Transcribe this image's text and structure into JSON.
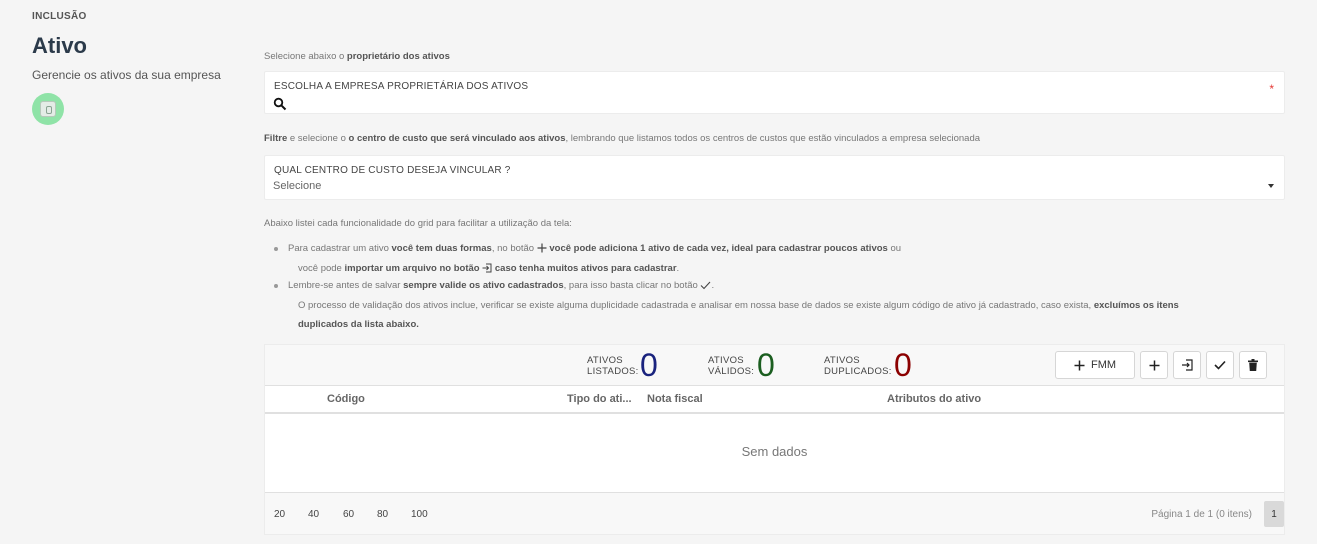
{
  "header": {
    "breadcrumb": "INCLUSÃO",
    "title": "Ativo",
    "subtitle": "Gerencie os ativos da sua empresa",
    "avatar_icon": "safe-icon",
    "avatar_color": "#8fe3a7"
  },
  "owner": {
    "hint_prefix": "Selecione abaixo o ",
    "hint_bold": "proprietário dos ativos",
    "label": "ESCOLHA A EMPRESA PROPRIETÁRIA DOS ATIVOS",
    "required_mark": "*",
    "value": ""
  },
  "cost_center": {
    "hint_bold1": "Filtre",
    "hint_mid": " e selecione o ",
    "hint_bold2": "o centro de custo que será vinculado aos ativos",
    "hint_rest": ", lembrando que listamos todos os centros de custos que estão vinculados a empresa selecionada",
    "label": "QUAL CENTRO DE CUSTO DESEJA VINCULAR ?",
    "value": "Selecione"
  },
  "instructions": {
    "intro": "Abaixo listei cada funcionalidade do grid para facilitar a utilização da tela:",
    "b1_a": "Para cadastrar um ativo ",
    "b1_b": "você tem duas formas",
    "b1_c": ", no botão ",
    "b1_d": " você pode adiciona 1 ativo de cada vez, ideal para cadastrar poucos ativos",
    "b1_e": " ou",
    "b1_f": "você pode ",
    "b1_g": "importar um arquivo no botão",
    "b1_h": " caso tenha muitos ativos para cadastrar",
    "b1_i": ".",
    "b2_a": "Lembre-se antes de salvar ",
    "b2_b": "sempre valide os ativo cadastrados",
    "b2_c": ", para isso basta clicar no botão",
    "b2_d": ".",
    "b2_e": "O processo de validação dos ativos inclue, verificar se existe alguma duplicidade cadastrada e analisar em nossa base de dados se existe algum código de ativo já cadastrado, caso exista, ",
    "b2_f": "excluímos os itens",
    "b2_g": "duplicados da lista abaixo."
  },
  "counters": {
    "listed_line1": "ATIVOS",
    "listed_line2": "LISTADOS:",
    "listed_value": "0",
    "listed_color": "#1a237e",
    "valid_line1": "ATIVOS",
    "valid_line2": "VÁLIDOS:",
    "valid_value": "0",
    "valid_color": "#1b5e20",
    "dup_line1": "ATIVOS",
    "dup_line2": "DUPLICADOS:",
    "dup_value": "0",
    "dup_color": "#8b0000"
  },
  "toolbar": {
    "fmm_label": "FMM"
  },
  "table": {
    "columns": [
      "Código",
      "Tipo do ati...",
      "Nota fiscal",
      "Atributos do ativo"
    ],
    "empty_text": "Sem dados"
  },
  "pager": {
    "sizes": [
      "20",
      "40",
      "60",
      "80",
      "100"
    ],
    "info": "Página 1 de 1 (0 itens)",
    "current": "1"
  }
}
